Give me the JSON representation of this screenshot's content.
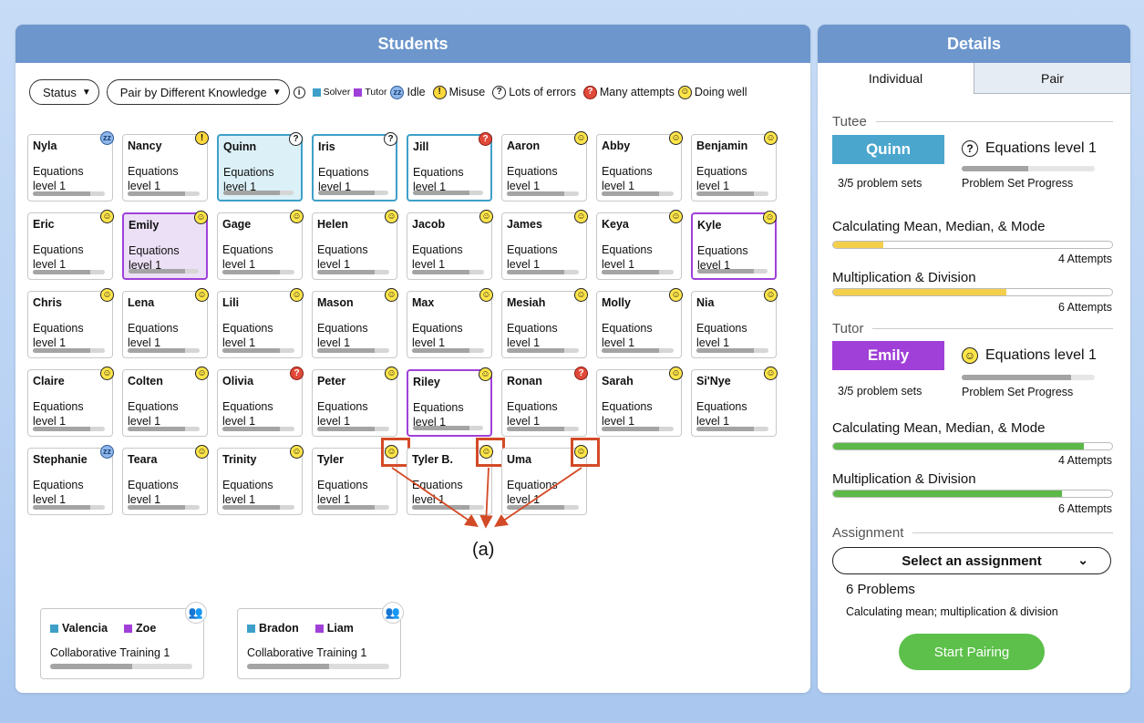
{
  "students_panel": {
    "title": "Students",
    "status_filter": "Status",
    "pair_mode": "Pair by Different Knowledge",
    "legend": {
      "solver": "Solver",
      "tutor": "Tutor",
      "idle": "Idle",
      "misuse": "Misuse",
      "lots_of_errors": "Lots of errors",
      "many_attempts": "Many attempts",
      "doing_well": "Doing well"
    },
    "colors": {
      "solver": "#3ea0c8",
      "tutor": "#a040d8",
      "header": "#6c96cc",
      "highlight": "#d34a26"
    },
    "level_line1": "Equations",
    "level_line2": "level 1",
    "students": [
      {
        "name": "Nyla",
        "status": "idle",
        "progress": 0.8
      },
      {
        "name": "Nancy",
        "status": "misuse",
        "progress": 0.8
      },
      {
        "name": "Quinn",
        "status": "lots_of_errors",
        "progress": 0.8,
        "select": "solver-fill"
      },
      {
        "name": "Iris",
        "status": "lots_of_errors",
        "progress": 0.8,
        "select": "solver"
      },
      {
        "name": "Jill",
        "status": "many_attempts",
        "progress": 0.8,
        "select": "solver"
      },
      {
        "name": "Aaron",
        "status": "doing_well",
        "progress": 0.8
      },
      {
        "name": "Abby",
        "status": "doing_well",
        "progress": 0.8
      },
      {
        "name": "Benjamin",
        "status": "doing_well",
        "progress": 0.8
      },
      {
        "name": "Eric",
        "status": "doing_well",
        "progress": 0.8
      },
      {
        "name": "Emily",
        "status": "doing_well",
        "progress": 0.8,
        "select": "tutor-fill"
      },
      {
        "name": "Gage",
        "status": "doing_well",
        "progress": 0.8
      },
      {
        "name": "Helen",
        "status": "doing_well",
        "progress": 0.8
      },
      {
        "name": "Jacob",
        "status": "doing_well",
        "progress": 0.8
      },
      {
        "name": "James",
        "status": "doing_well",
        "progress": 0.8
      },
      {
        "name": "Keya",
        "status": "doing_well",
        "progress": 0.8
      },
      {
        "name": "Kyle",
        "status": "doing_well",
        "progress": 0.8,
        "select": "tutor"
      },
      {
        "name": "Chris",
        "status": "doing_well",
        "progress": 0.8
      },
      {
        "name": "Lena",
        "status": "doing_well",
        "progress": 0.8
      },
      {
        "name": "Lili",
        "status": "doing_well",
        "progress": 0.8
      },
      {
        "name": "Mason",
        "status": "doing_well",
        "progress": 0.8
      },
      {
        "name": "Max",
        "status": "doing_well",
        "progress": 0.8
      },
      {
        "name": "Mesiah",
        "status": "doing_well",
        "progress": 0.8
      },
      {
        "name": "Molly",
        "status": "doing_well",
        "progress": 0.8
      },
      {
        "name": "Nia",
        "status": "doing_well",
        "progress": 0.8
      },
      {
        "name": "Claire",
        "status": "doing_well",
        "progress": 0.8
      },
      {
        "name": "Colten",
        "status": "doing_well",
        "progress": 0.8
      },
      {
        "name": "Olivia",
        "status": "many_attempts",
        "progress": 0.8
      },
      {
        "name": "Peter",
        "status": "doing_well",
        "progress": 0.8
      },
      {
        "name": "Riley",
        "status": "doing_well",
        "progress": 0.8,
        "select": "tutor"
      },
      {
        "name": "Ronan",
        "status": "many_attempts",
        "progress": 0.8
      },
      {
        "name": "Sarah",
        "status": "doing_well",
        "progress": 0.8
      },
      {
        "name": "Si'Nye",
        "status": "doing_well",
        "progress": 0.8
      },
      {
        "name": "Stephanie",
        "status": "idle",
        "progress": 0.8
      },
      {
        "name": "Teara",
        "status": "doing_well",
        "progress": 0.8
      },
      {
        "name": "Trinity",
        "status": "doing_well",
        "progress": 0.8
      },
      {
        "name": "Tyler",
        "status": "doing_well",
        "progress": 0.8,
        "highlight": true
      },
      {
        "name": "Tyler B.",
        "status": "doing_well",
        "progress": 0.8,
        "highlight": true
      },
      {
        "name": "Uma",
        "status": "doing_well",
        "progress": 0.8,
        "highlight": true
      }
    ],
    "annotation": "(a)",
    "pairs": [
      {
        "solver": "Valencia",
        "tutor": "Zoe",
        "activity": "Collaborative Training 1",
        "progress": 0.58
      },
      {
        "solver": "Bradon",
        "tutor": "Liam",
        "activity": "Collaborative Training 1",
        "progress": 0.58
      }
    ]
  },
  "details_panel": {
    "title": "Details",
    "tabs": [
      "Individual",
      "Pair"
    ],
    "tutee": {
      "label": "Tutee",
      "name": "Quinn",
      "status": "lots_of_errors",
      "level": "Equations level 1",
      "problem_sets": "3/5 problem sets",
      "progress_label": "Problem Set Progress",
      "progress": 0.5,
      "skills": [
        {
          "name": "Calculating Mean, Median, & Mode",
          "attempts": "4 Attempts",
          "fill": 0.18,
          "color": "#f4cf4c"
        },
        {
          "name": "Multiplication & Division",
          "attempts": "6 Attempts",
          "fill": 0.62,
          "color": "#f4cf4c"
        }
      ]
    },
    "tutor": {
      "label": "Tutor",
      "name": "Emily",
      "status": "doing_well",
      "level": "Equations level 1",
      "problem_sets": "3/5 problem sets",
      "progress_label": "Problem Set Progress",
      "progress": 0.82,
      "skills": [
        {
          "name": "Calculating Mean, Median, & Mode",
          "attempts": "4 Attempts",
          "fill": 0.9,
          "color": "#5cb848"
        },
        {
          "name": "Multiplication & Division",
          "attempts": "6 Attempts",
          "fill": 0.82,
          "color": "#5cb848"
        }
      ]
    },
    "assignment": {
      "label": "Assignment",
      "select_label": "Select an assignment",
      "problems": "6 Problems",
      "description": "Calculating mean; multiplication & division"
    },
    "start_button": "Start Pairing",
    "colors": {
      "tutee": "#4aa6cc",
      "tutor": "#a040d8",
      "start": "#5cc04a"
    }
  }
}
